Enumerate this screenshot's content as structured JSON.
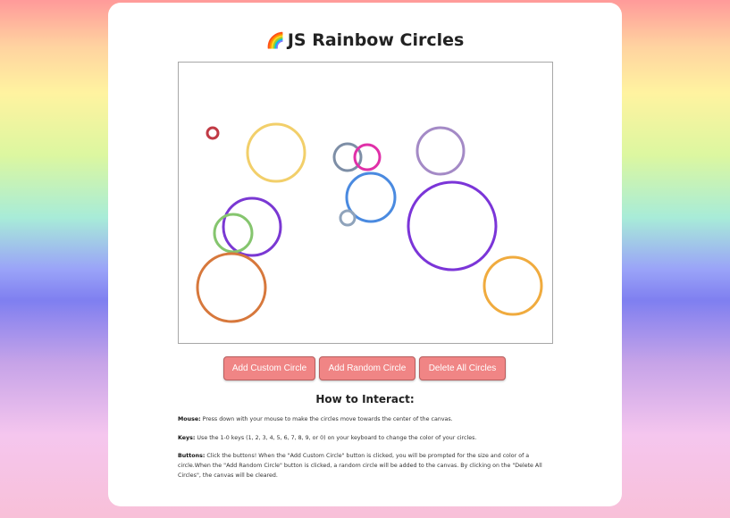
{
  "page": {
    "title_icon": "🌈",
    "title": "JS Rainbow Circles"
  },
  "canvas": {
    "circles": [
      {
        "color": "#c13a45",
        "r": 6
      },
      {
        "color": "#f2cf6a",
        "r": 32
      },
      {
        "color": "#7d8ea6",
        "r": 15
      },
      {
        "color": "#e030a8",
        "r": 14
      },
      {
        "color": "#a48ac6",
        "r": 26
      },
      {
        "color": "#4a8ae0",
        "r": 27
      },
      {
        "color": "#8fa3bb",
        "r": 8
      },
      {
        "color": "#7b35d8",
        "r": 49
      },
      {
        "color": "#7a38d3",
        "r": 32
      },
      {
        "color": "#85c56e",
        "r": 21
      },
      {
        "color": "#d7783c",
        "r": 38
      },
      {
        "color": "#f0ab3e",
        "r": 32
      }
    ]
  },
  "buttons": {
    "custom": "Add Custom Circle",
    "random": "Add Random Circle",
    "delete": "Delete All Circles"
  },
  "instructions": {
    "heading": "How to Interact:",
    "mouse_label": "Mouse:",
    "mouse_text": " Press down with your mouse to make the circles move towards the center of the canvas.",
    "keys_label": "Keys:",
    "keys_text": " Use the 1-0 keys (1, 2, 3, 4, 5, 6, 7, 8, 9, or 0) on your keyboard to change the color of your circles.",
    "buttons_label": "Buttons:",
    "buttons_text": " Click the buttons! When the \"Add Custom Circle\" button is clicked, you will be prompted for the size and color of a circle.When the \"Add Random Circle\" button is clicked, a random circle will be added to the canvas. By clicking on the \"Delete All Circles\", the canvas will be cleared."
  }
}
